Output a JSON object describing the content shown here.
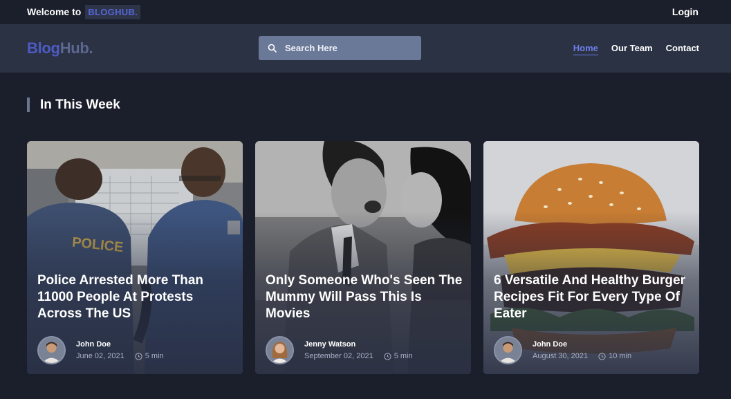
{
  "topbar": {
    "welcome_text": "Welcome to",
    "brand_tag": "BLOGHUB.",
    "login_label": "Login"
  },
  "header": {
    "logo_part1": "Blog",
    "logo_part2": "Hub.",
    "search_placeholder": "Search Here",
    "nav": [
      {
        "label": "Home",
        "active": true
      },
      {
        "label": "Our Team",
        "active": false
      },
      {
        "label": "Contact",
        "active": false
      }
    ]
  },
  "section": {
    "title": "In This Week"
  },
  "cards": [
    {
      "title": "Police Arrested More Than 11000 People At Protests Across The US",
      "author": "John Doe",
      "date": "June 02, 2021",
      "read_time": "5 min",
      "image": "police-officers-photo"
    },
    {
      "title": "Only Someone Who's Seen The Mummy Will Pass This Is Movies",
      "author": "Jenny Watson",
      "date": "September 02, 2021",
      "read_time": "5 min",
      "image": "black-and-white-couple-photo"
    },
    {
      "title": "6 Versatile And Healthy Burger Recipes Fit For Every Type Of Eater",
      "author": "John Doe",
      "date": "August 30, 2021",
      "read_time": "10 min",
      "image": "burger-photo"
    }
  ],
  "colors": {
    "background": "#1b1f2b",
    "header": "#2b3244",
    "accent": "#6f7eea",
    "brand": "#4d5bc4"
  }
}
